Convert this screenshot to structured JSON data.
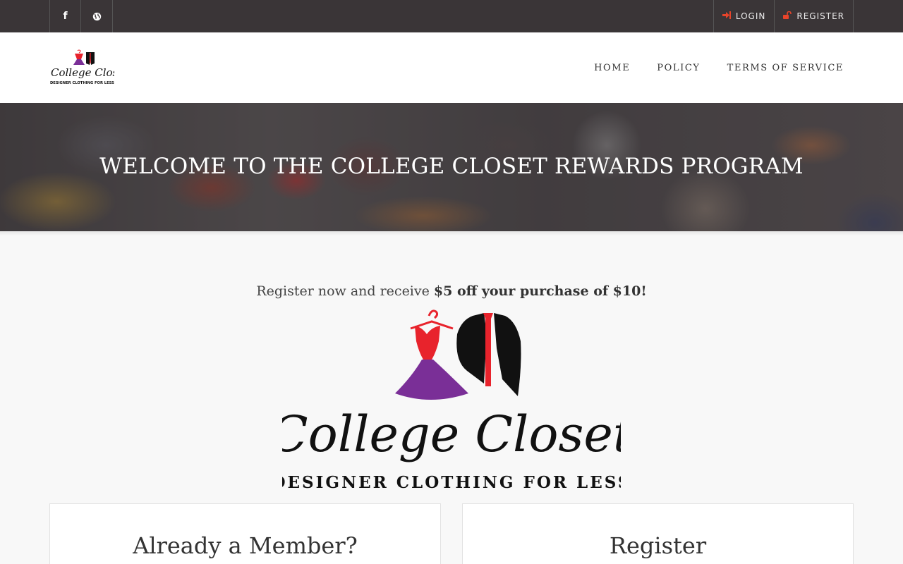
{
  "topbar": {
    "social": [
      {
        "icon": "facebook-icon",
        "glyph": "f"
      },
      {
        "icon": "globe-icon",
        "glyph": "🌐"
      }
    ],
    "login_label": "LOGIN",
    "register_label": "REGISTER"
  },
  "nav": {
    "items": [
      "HOME",
      "POLICY",
      "TERMS OF SERVICE"
    ]
  },
  "hero": {
    "title": "WELCOME TO THE COLLEGE CLOSET REWARDS PROGRAM"
  },
  "promo": {
    "text": "Register now and receive ",
    "bold": "$5 off your purchase of $10!"
  },
  "logo": {
    "script_text": "College Closet",
    "tagline": "DESIGNER CLOTHING FOR LESS",
    "colors": {
      "dress_top": "#e8232c",
      "dress_skirt": "#7a2f97",
      "jacket": "#111111",
      "tie": "#e8232c"
    }
  },
  "cards": {
    "member_title": "Already a Member?",
    "register_title": "Register"
  },
  "colors": {
    "topbar": "#3a3537",
    "accent": "#e8442a",
    "page_bg": "#f8f8f8"
  }
}
